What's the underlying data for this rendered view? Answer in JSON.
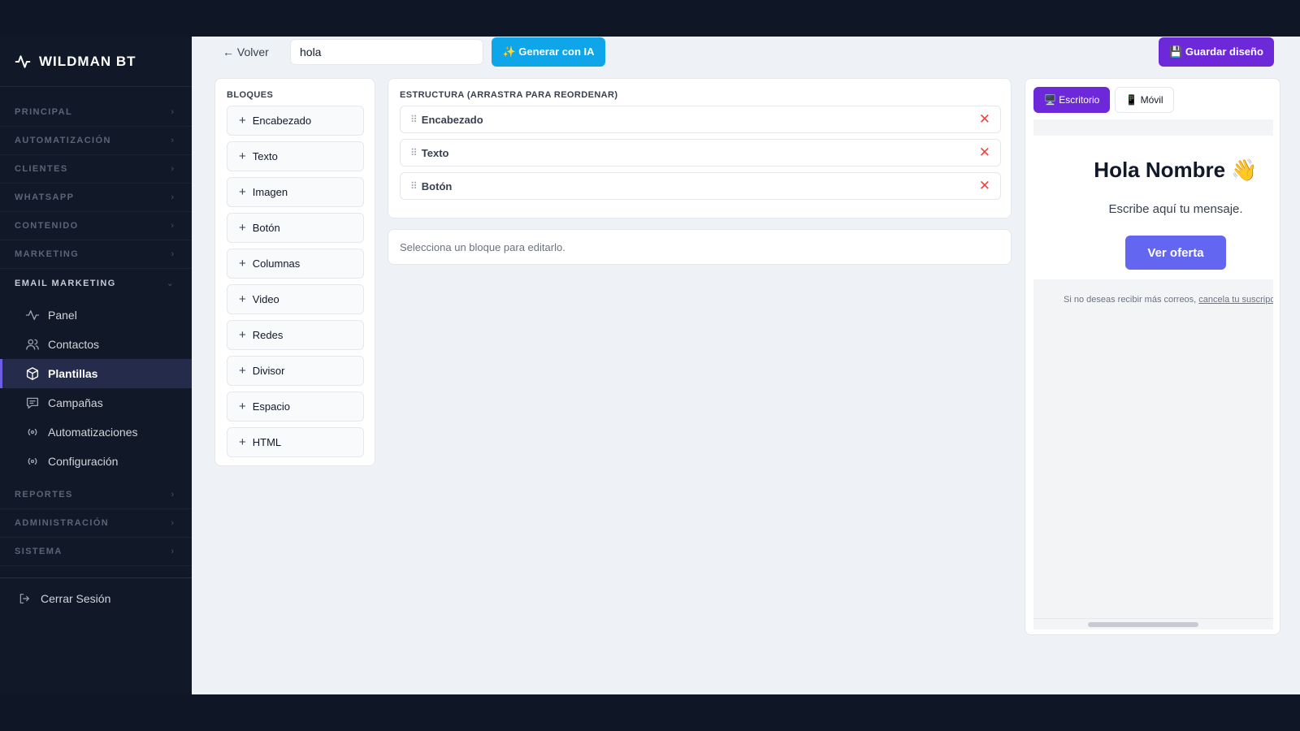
{
  "brand": {
    "name": "WILDMAN BT",
    "icon": "activity-icon"
  },
  "sidebar": {
    "sections": [
      {
        "label": "PRINCIPAL"
      },
      {
        "label": "AUTOMATIZACIÓN"
      },
      {
        "label": "CLIENTES"
      },
      {
        "label": "WHATSAPP"
      },
      {
        "label": "CONTENIDO"
      },
      {
        "label": "MARKETING"
      },
      {
        "label": "EMAIL MARKETING",
        "expanded": true
      },
      {
        "label": "REPORTES"
      },
      {
        "label": "ADMINISTRACIÓN"
      },
      {
        "label": "SISTEMA"
      }
    ],
    "email_items": [
      {
        "label": "Panel",
        "icon": "activity-icon"
      },
      {
        "label": "Contactos",
        "icon": "users-icon"
      },
      {
        "label": "Plantillas",
        "icon": "cube-icon",
        "active": true
      },
      {
        "label": "Campañas",
        "icon": "chat-icon"
      },
      {
        "label": "Automatizaciones",
        "icon": "broadcast-icon"
      },
      {
        "label": "Configuración",
        "icon": "broadcast-icon"
      }
    ],
    "logout_label": "Cerrar Sesión"
  },
  "toolbar": {
    "back_label": "← Volver",
    "name_value": "hola",
    "ai_label": "✨ Generar con IA",
    "save_label": "💾 Guardar diseño"
  },
  "blocks": {
    "title": "BLOQUES",
    "items": [
      {
        "label": "Encabezado"
      },
      {
        "label": "Texto"
      },
      {
        "label": "Imagen"
      },
      {
        "label": "Botón"
      },
      {
        "label": "Columnas"
      },
      {
        "label": "Video"
      },
      {
        "label": "Redes"
      },
      {
        "label": "Divisor"
      },
      {
        "label": "Espacio"
      },
      {
        "label": "HTML"
      }
    ]
  },
  "structure": {
    "title": "ESTRUCTURA (ARRASTRA PARA REORDENAR)",
    "rows": [
      {
        "label": "Encabezado"
      },
      {
        "label": "Texto"
      },
      {
        "label": "Botón"
      }
    ]
  },
  "editor_hint": "Selecciona un bloque para editarlo.",
  "preview": {
    "tabs": [
      {
        "label": "🖥️ Escritorio",
        "active": true
      },
      {
        "label": "📱 Móvil"
      }
    ],
    "email": {
      "heading": "Hola Nombre 👋",
      "text": "Escribe aquí tu mensaje.",
      "button": "Ver oferta",
      "footer_prefix": "Si no deseas recibir más correos, ",
      "footer_link": "cancela tu suscripción"
    }
  },
  "colors": {
    "sidebar_bg": "#111827",
    "accent_purple": "#6d28d9",
    "ai_blue": "#0ea5e9",
    "email_button": "#6366f1",
    "delete_red": "#ef4444"
  }
}
